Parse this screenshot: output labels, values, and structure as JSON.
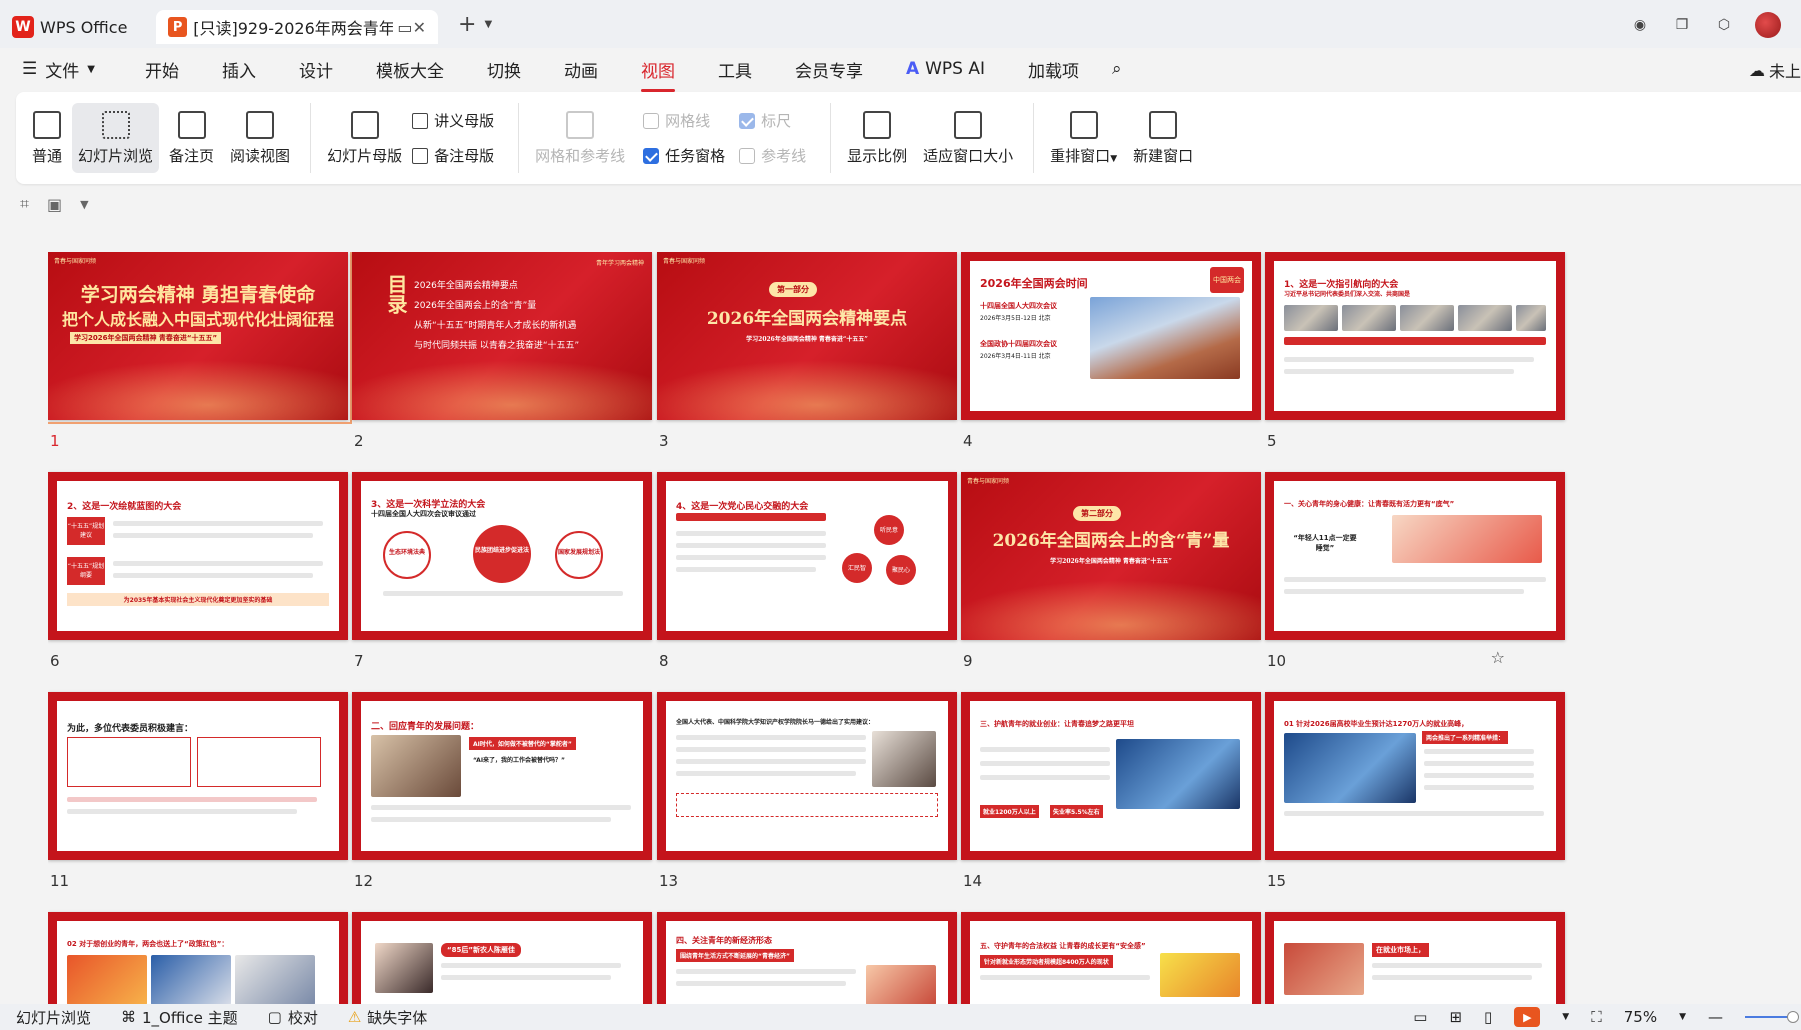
{
  "titlebar": {
    "app_tab": "WPS Office",
    "doc_tab": "[只读]929-2026年两会青年(",
    "plus": "+",
    "caret": "⌄"
  },
  "menu": {
    "file": "文件",
    "items": [
      "开始",
      "插入",
      "设计",
      "模板大全",
      "切换",
      "动画",
      "视图",
      "工具",
      "会员专享",
      "WPS AI",
      "加载项"
    ],
    "active": "视图",
    "cloud_label": "未上"
  },
  "ribbon": {
    "normal": "普通",
    "slide_sorter": "幻灯片浏览",
    "notes_page": "备注页",
    "reading_view": "阅读视图",
    "slide_master": "幻灯片母版",
    "handout_master": "讲义母版",
    "notes_master": "备注母版",
    "grid_guides": "网格和参考线",
    "gridlines": "网格线",
    "ruler": "标尺",
    "task_pane": "任务窗格",
    "guides": "参考线",
    "zoom": "显示比例",
    "fit_window": "适应窗口大小",
    "arrange": "重排窗口",
    "new_window": "新建窗口"
  },
  "slides": [
    {
      "num": "1",
      "title": "学习两会精神 勇担青春使命",
      "sub": "把个人成长融入中国式现代化壮阔征程",
      "tag": "学习2026年全国两会精神 青春奋进“十五五”",
      "footer": "青春与国家同频"
    },
    {
      "num": "2",
      "toc": [
        "2026年全国两会精神要点",
        "2026年全国两会上的含“青”量",
        "从新“十五五”时期青年人才成长的新机遇",
        "与时代同频共振 以青春之我奋进“十五五”"
      ],
      "title": "目录",
      "footer": "青年学习两会精神"
    },
    {
      "num": "3",
      "part": "第一部分",
      "title": "2026年全国两会精神要点",
      "sub": "学习2026年全国两会精神 青春奋进“十五五”",
      "footer": "青春与国家同频"
    },
    {
      "num": "4",
      "title": "2026年全国两会时间",
      "npc": "十四届全国人大四次会议",
      "npc_date": "2026年3月5日-12日 北京",
      "cppcc": "全国政协十四届四次会议",
      "cppcc_date": "2026年3月4日-11日 北京",
      "badge": "中国两会"
    },
    {
      "num": "5",
      "title": "1、这是一次指引航向的大会",
      "sub": "习近平总书记同代表委员们深入交流、共商国是"
    },
    {
      "num": "6",
      "title": "2、这是一次绘就蓝图的大会",
      "box1": "“十五五”规划建议",
      "box2": "“十五五”规划纲要",
      "foot": "为2035年基本实现社会主义现代化奠定更加坚实的基础"
    },
    {
      "num": "7",
      "title": "3、这是一次科学立法的大会",
      "sub": "十四届全国人大四次会议审议通过",
      "c1": "生态环境法典",
      "c2": "民族团结进步促进法",
      "c3": "国家发展规划法"
    },
    {
      "num": "8",
      "title": "4、这是一次党心民心交融的大会",
      "c1": "听民意",
      "c2": "汇民智",
      "c3": "聚民心"
    },
    {
      "num": "9",
      "part": "第二部分",
      "title": "2026年全国两会上的含“青”量",
      "sub": "学习2026年全国两会精神 青春奋进“十五五”",
      "footer": "青春与国家同频"
    },
    {
      "num": "10",
      "title": "一、关心青年的身心健康：让青春既有活力更有“底气”",
      "quote": "“年轻人11点一定要睡觉”"
    },
    {
      "num": "11",
      "title": "为此，多位代表委员积极建言："
    },
    {
      "num": "12",
      "title": "二、回应青年的发展问题：",
      "q1": "AI时代，如何做不被替代的“掌舵者”",
      "q2": "“AI来了，我的工作会被替代吗？”"
    },
    {
      "num": "13",
      "title": "全国人大代表、中国科学院大学知识产权学院院长马一德给出了实用建议："
    },
    {
      "num": "14",
      "title": "三、护航青年的就业创业：让青春追梦之路更平坦",
      "s1": "就业1200万人以上",
      "s2": "失业率5.5%左右"
    },
    {
      "num": "15",
      "title": "01 针对2026届高校毕业生预计达1270万人的就业高峰，",
      "sub": "两会推出了一系列精准举措："
    },
    {
      "num": "16",
      "title": "02 对于想创业的青年，两会也送上了“政策红包”："
    },
    {
      "num": "17",
      "title": "“85后”新农人陈雁佳"
    },
    {
      "num": "18",
      "title": "四、关注青年的新经济形态",
      "sub": "围绕青年生活方式不断延展的“青春经济”"
    },
    {
      "num": "19",
      "title": "五、守护青年的合法权益 让青春的成长更有“安全感”",
      "sub": "针对新就业形态劳动者规模超8400万人的现状"
    },
    {
      "num": "20",
      "title": "在就业市场上，"
    }
  ],
  "status": {
    "view": "幻灯片浏览",
    "theme": "1_Office 主题",
    "proof": "校对",
    "missing_font": "缺失字体",
    "zoom": "75%"
  }
}
